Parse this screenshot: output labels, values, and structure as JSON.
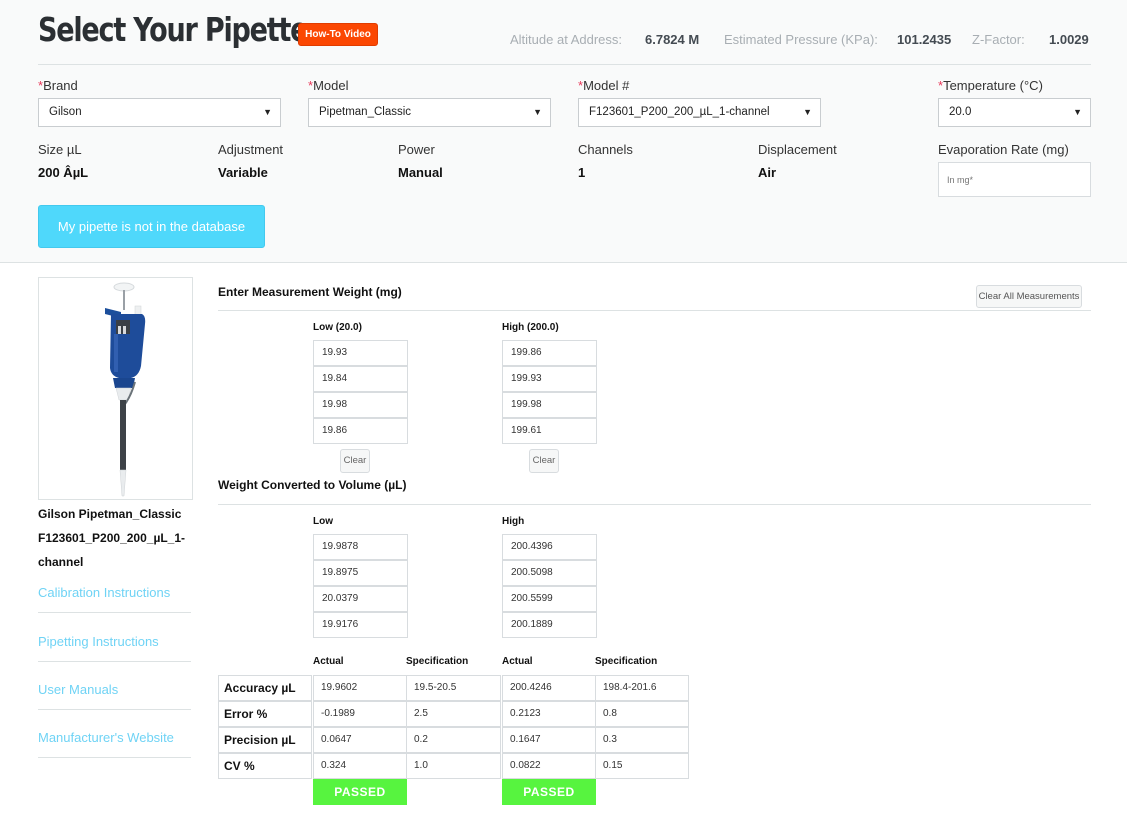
{
  "header": {
    "title": "Select Your Pipette",
    "howto_button": "How-To Video",
    "altitude_label": "Altitude at Address:",
    "altitude_value": "6.7824 M",
    "pressure_label": "Estimated Pressure (KPa):",
    "pressure_value": "101.2435",
    "zfactor_label": "Z-Factor:",
    "zfactor_value": "1.0029"
  },
  "form": {
    "required_mark": "*",
    "brand": {
      "label": "Brand",
      "value": "Gilson"
    },
    "model": {
      "label": "Model",
      "value": "Pipetman_Classic"
    },
    "model_number": {
      "label": "Model #",
      "value": "F123601_P200_200_µL_1-channel"
    },
    "temperature": {
      "label": "Temperature (°C)",
      "value": "20.0"
    },
    "dropdown_arrow": "▼"
  },
  "specs": {
    "size": {
      "label": "Size µL",
      "value": "200 ÂµL"
    },
    "adjustment": {
      "label": "Adjustment",
      "value": "Variable"
    },
    "power": {
      "label": "Power",
      "value": "Manual"
    },
    "channels": {
      "label": "Channels",
      "value": "1"
    },
    "displacement": {
      "label": "Displacement",
      "value": "Air"
    },
    "evaporation": {
      "label": "Evaporation Rate (mg)",
      "placeholder": "In mg*",
      "value": ""
    }
  },
  "not_in_db_button": "My pipette is not in the database",
  "sidebar": {
    "pipette_name": "Gilson Pipetman_Classic F123601_P200_200_µL_1-channel",
    "links": [
      "Calibration Instructions",
      "Pipetting Instructions",
      "User Manuals",
      "Manufacturer's Website"
    ]
  },
  "measurement": {
    "title": "Enter Measurement Weight (mg)",
    "clear_all": "Clear All Measurements",
    "low_header": "Low (20.0)",
    "high_header": "High (200.0)",
    "low_values": [
      "19.93",
      "19.84",
      "19.98",
      "19.86"
    ],
    "high_values": [
      "199.86",
      "199.93",
      "199.98",
      "199.61"
    ],
    "clear_label": "Clear"
  },
  "volume": {
    "title": "Weight Converted to Volume (µL)",
    "low_header": "Low",
    "high_header": "High",
    "low_values": [
      "19.9878",
      "19.8975",
      "20.0379",
      "19.9176"
    ],
    "high_values": [
      "200.4396",
      "200.5098",
      "200.5599",
      "200.1889"
    ]
  },
  "results": {
    "actual_header": "Actual",
    "spec_header": "Specification",
    "rows": [
      {
        "label": "Accuracy µL",
        "low_actual": "19.9602",
        "low_spec": "19.5-20.5",
        "high_actual": "200.4246",
        "high_spec": "198.4-201.6"
      },
      {
        "label": "Error %",
        "low_actual": "-0.1989",
        "low_spec": "2.5",
        "high_actual": "0.2123",
        "high_spec": "0.8"
      },
      {
        "label": "Precision µL",
        "low_actual": "0.0647",
        "low_spec": "0.2",
        "high_actual": "0.1647",
        "high_spec": "0.3"
      },
      {
        "label": "CV %",
        "low_actual": "0.324",
        "low_spec": "1.0",
        "high_actual": "0.0822",
        "high_spec": "0.15"
      }
    ],
    "low_status": "PASSED",
    "high_status": "PASSED"
  },
  "colors": {
    "accent_orange": "#fb4702",
    "button_cyan": "#4fd8fb",
    "link_cyan": "#6fd3f5",
    "passed_green": "#57f43f",
    "required_red": "#e8385a"
  }
}
